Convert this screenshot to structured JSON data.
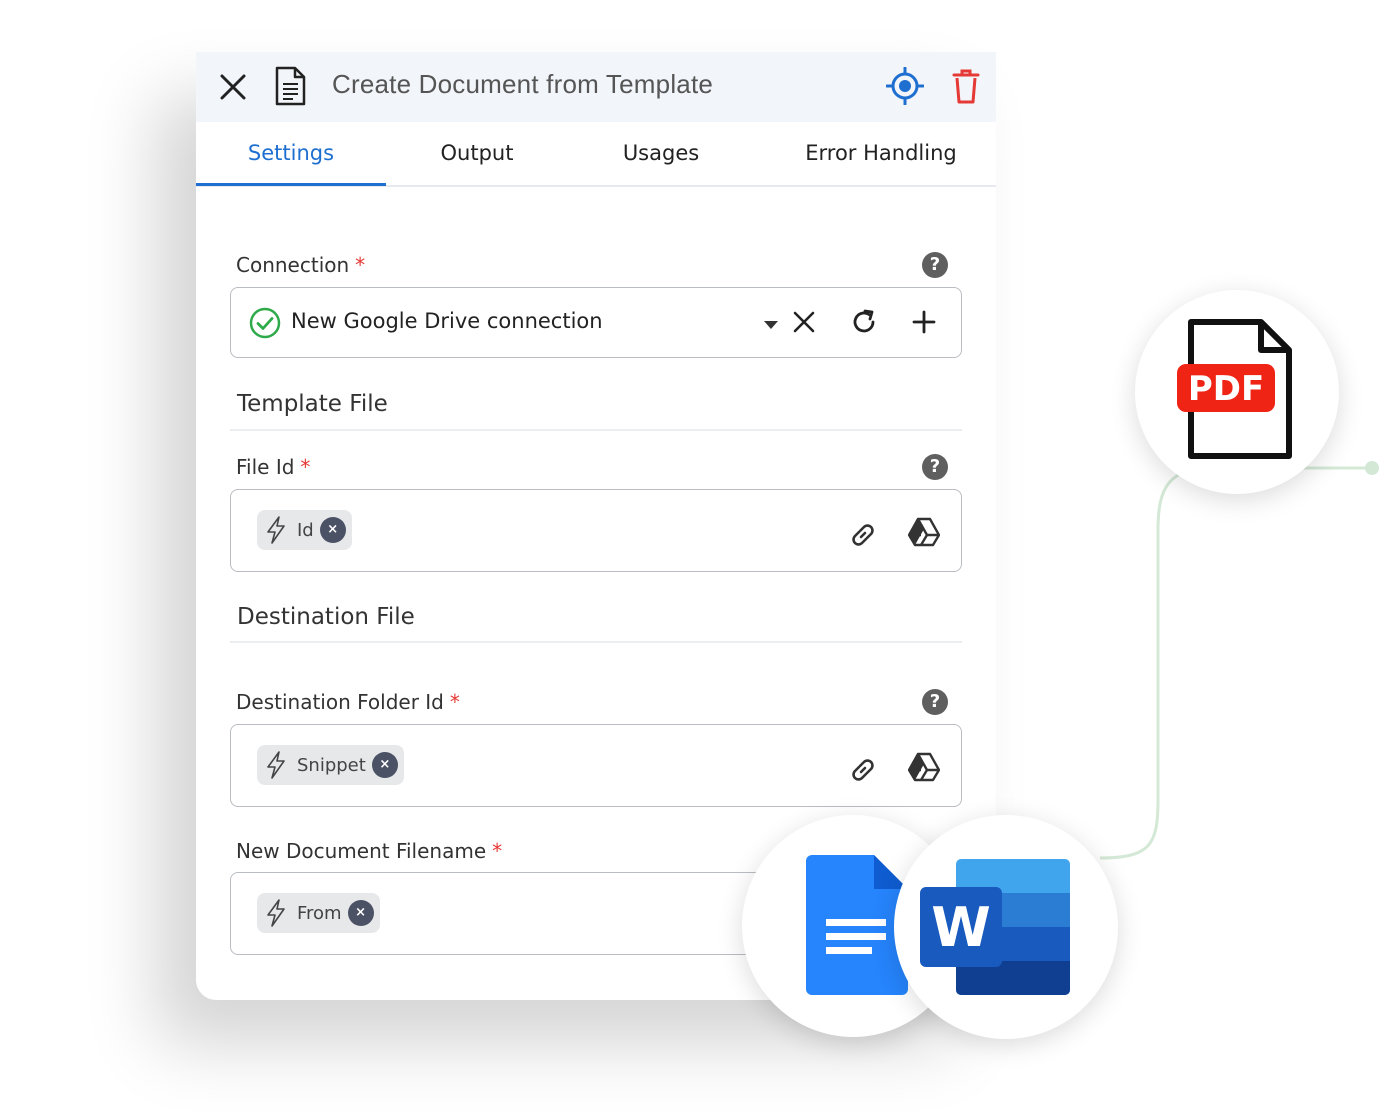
{
  "header": {
    "title": "Create Document from Template",
    "close_icon": "close-icon",
    "document_icon": "document-icon",
    "target_icon": "target-icon",
    "delete_icon": "trash-icon"
  },
  "tabs": [
    {
      "label": "Settings",
      "active": true
    },
    {
      "label": "Output",
      "active": false
    },
    {
      "label": "Usages",
      "active": false
    },
    {
      "label": "Error Handling",
      "active": false
    }
  ],
  "connection": {
    "label": "Connection",
    "required_mark": "*",
    "help": "?",
    "value": "New Google Drive connection",
    "status_icon": "check-circle-icon"
  },
  "template_section": {
    "title": "Template File"
  },
  "file_id": {
    "label": "File Id",
    "required_mark": "*",
    "help": "?",
    "chip": {
      "text": "Id",
      "remove": "×"
    }
  },
  "destination_section": {
    "title": "Destination File"
  },
  "destination_folder": {
    "label": "Destination Folder Id",
    "required_mark": "*",
    "help": "?",
    "chip": {
      "text": "Snippet",
      "remove": "×"
    }
  },
  "new_filename": {
    "label": "New Document Filename",
    "required_mark": "*",
    "chip": {
      "text": "From",
      "remove": "×"
    }
  },
  "badges": {
    "pdf_text": "PDF",
    "word_letter": "W"
  },
  "colors": {
    "accent": "#1e6fd0",
    "danger": "#e53935",
    "success": "#2eaa4a",
    "pdf_red": "#f02415",
    "gdocs_blue": "#2684fc",
    "word_blue": "#185abd"
  }
}
